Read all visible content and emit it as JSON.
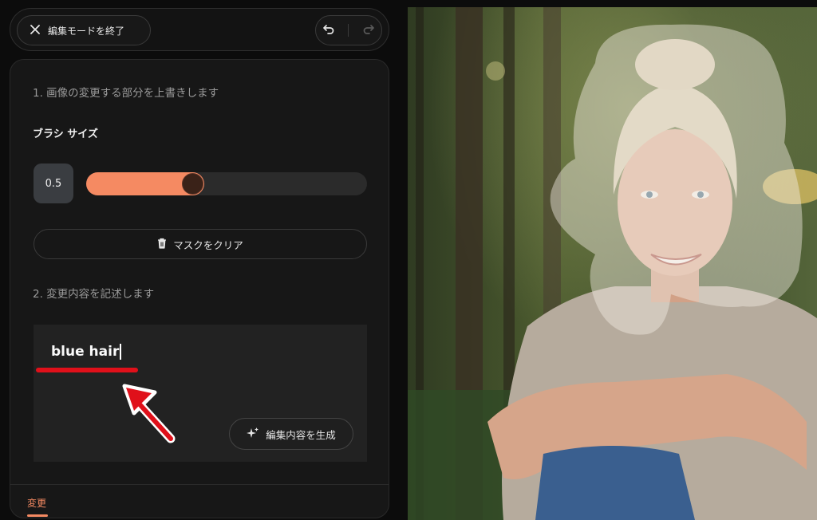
{
  "header": {
    "exit_label": "編集モードを終了",
    "icons": {
      "close": "close-icon",
      "undo": "undo-icon",
      "redo": "redo-icon"
    }
  },
  "panel": {
    "step1_label": "1. 画像の変更する部分を上書きします",
    "brush_size_label": "ブラシ サイズ",
    "brush_size_value": "0.5",
    "brush_slider_fraction": 0.38,
    "clear_mask_label": "マスクをクリア",
    "step2_label": "2. 変更内容を記述します",
    "prompt_value": "blue hair",
    "generate_label": "編集内容を生成",
    "tab_label": "変更"
  },
  "colors": {
    "accent": "#f58a62",
    "annotation_red": "#e0101a",
    "background": "#0c0c0c",
    "panel": "#171717"
  }
}
